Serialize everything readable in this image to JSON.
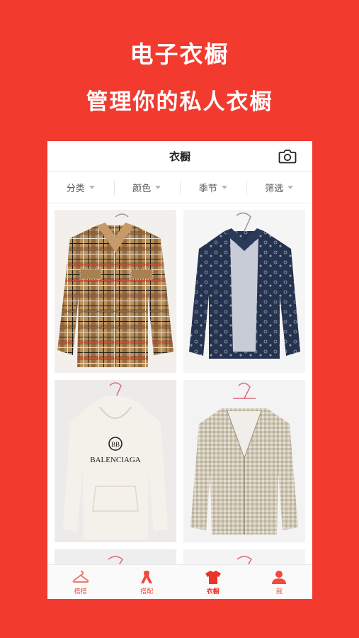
{
  "promo": {
    "title": "电子衣橱",
    "subtitle": "管理你的私人衣橱"
  },
  "nav": {
    "title": "衣橱",
    "camera_icon": "camera-icon"
  },
  "filters": [
    {
      "label": "分类"
    },
    {
      "label": "颜色"
    },
    {
      "label": "季节"
    },
    {
      "label": "筛选"
    }
  ],
  "garments": [
    {
      "name": "plaid-studded-shirt-jacket",
      "colors": [
        "#b8905c",
        "#7a5030",
        "#d94a3a"
      ]
    },
    {
      "name": "navy-monogram-denim-jacket",
      "colors": [
        "#26334f",
        "#c7ccd6"
      ]
    },
    {
      "name": "white-logo-hoodie",
      "print": "BALENCIAGA",
      "colors": [
        "#f4f1ea",
        "#1a1a1a"
      ]
    },
    {
      "name": "tweed-fringe-jacket",
      "colors": [
        "#cfc8b6",
        "#9a907a"
      ]
    }
  ],
  "tabbar": {
    "items": [
      {
        "label": "搭搭",
        "icon": "hanger-icon"
      },
      {
        "label": "搭配",
        "icon": "ribbon-icon"
      },
      {
        "label": "衣橱",
        "icon": "tshirt-icon",
        "active": true
      },
      {
        "label": "我",
        "icon": "user-icon"
      }
    ]
  },
  "colors": {
    "brand": "#f23a2f",
    "tab_active": "#e8362b"
  }
}
